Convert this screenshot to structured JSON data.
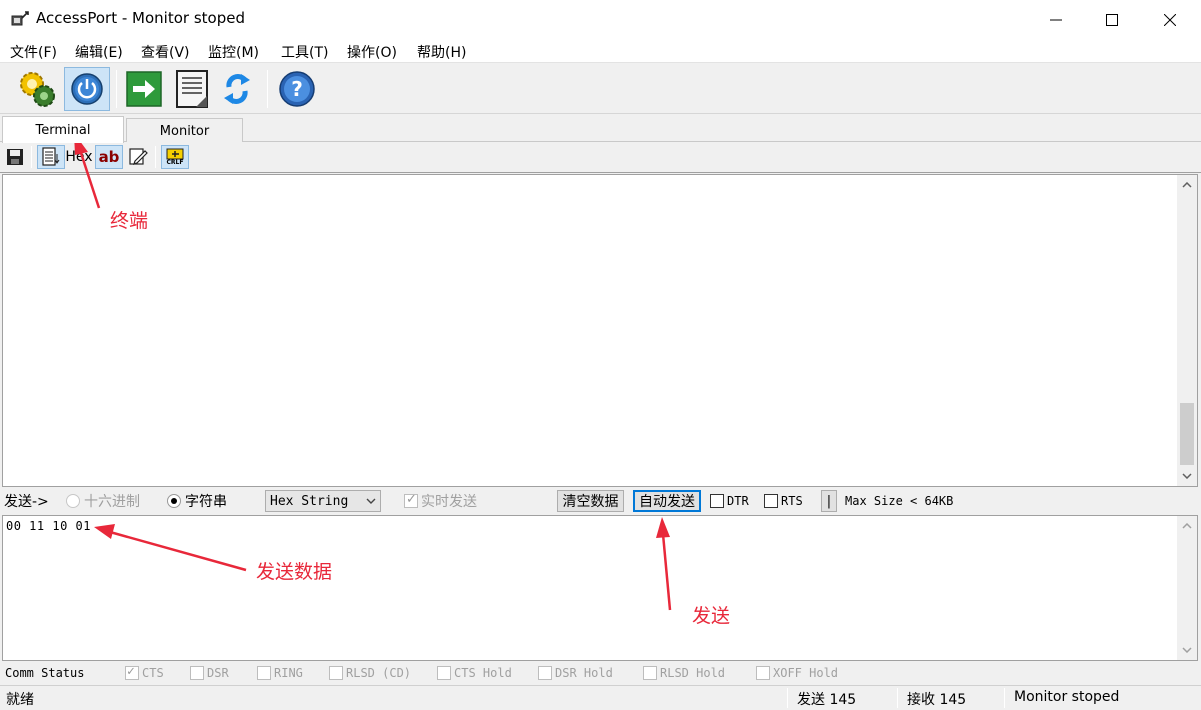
{
  "window": {
    "title": "AccessPort - Monitor  stoped"
  },
  "menu": {
    "items": [
      "文件(F)",
      "编辑(E)",
      "查看(V)",
      "监控(M)",
      "工具(T)",
      "操作(O)",
      "帮助(H)"
    ]
  },
  "toolbar": {
    "icons": [
      "settings-gear-icon",
      "power-icon",
      "run-arrow-icon",
      "document-icon",
      "refresh-icon",
      "help-icon"
    ]
  },
  "tabs": {
    "active": "Terminal",
    "inactive": "Monitor"
  },
  "subtoolbar": {
    "hex_label": "Hex",
    "ab_label": "ab",
    "crlf_label": "CRLF"
  },
  "sendbar": {
    "send_label": "发送->",
    "radio_hex": "十六进制",
    "radio_string": "字符串",
    "format_select": "Hex String",
    "realtime_send": "实时发送",
    "clear_button": "清空数据",
    "auto_send_button": "自动发送",
    "dtr": "DTR",
    "rts": "RTS",
    "pipe": "|",
    "max_size": "Max Size < 64KB"
  },
  "send_area": {
    "content": "00 11 10 01"
  },
  "comm_status": {
    "label": "Comm Status",
    "items": [
      "CTS",
      "DSR",
      "RING",
      "RLSD (CD)",
      "CTS Hold",
      "DSR Hold",
      "RLSD Hold",
      "XOFF Hold"
    ]
  },
  "status": {
    "ready": "就绪",
    "sent": "发送 145",
    "received": "接收 145",
    "monitor": "Monitor  stoped"
  },
  "annotations": {
    "terminal": "终端",
    "send_data": "发送数据",
    "send": "发送"
  },
  "colors": {
    "annotation": "#e8283a",
    "focus": "#0078d7",
    "pressed": "#cde4f7"
  }
}
